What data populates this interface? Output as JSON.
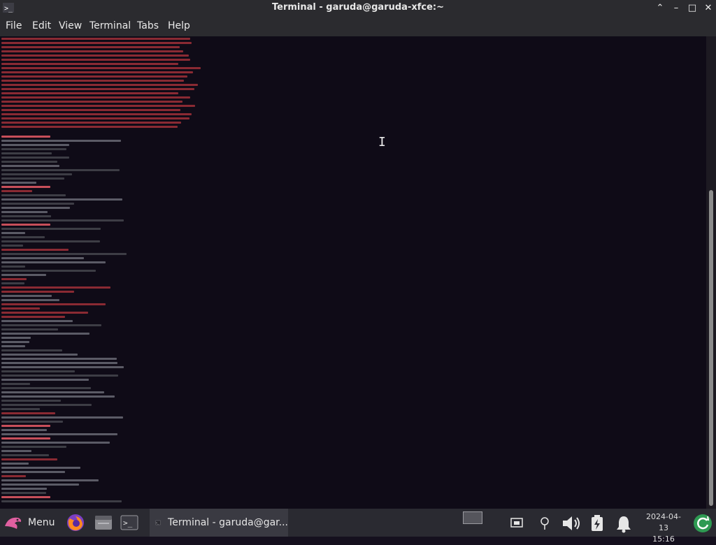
{
  "window": {
    "title": "Terminal - garuda@garuda-xfce:~"
  },
  "menubar": {
    "items": [
      "File",
      "Edit",
      "View",
      "Terminal",
      "Tabs",
      "Help"
    ]
  },
  "taskbar": {
    "menu_label": "Menu",
    "active_task_label": "Terminal - garuda@gar...",
    "date": "2024-04-13",
    "time": "15:16",
    "icons": [
      "garuda-menu-icon",
      "firefox-icon",
      "file-manager-icon",
      "terminal-launcher-icon",
      "terminal-task-icon",
      "workspace-icon",
      "screenshot-icon",
      "network-icon",
      "volume-icon",
      "power-icon",
      "notification-bell-icon",
      "update-icon"
    ]
  },
  "colors": {
    "background": "#0f0b17",
    "error_text": "#8a2a33",
    "prompt": "#c74f5a",
    "panel": "#2a2a31"
  }
}
